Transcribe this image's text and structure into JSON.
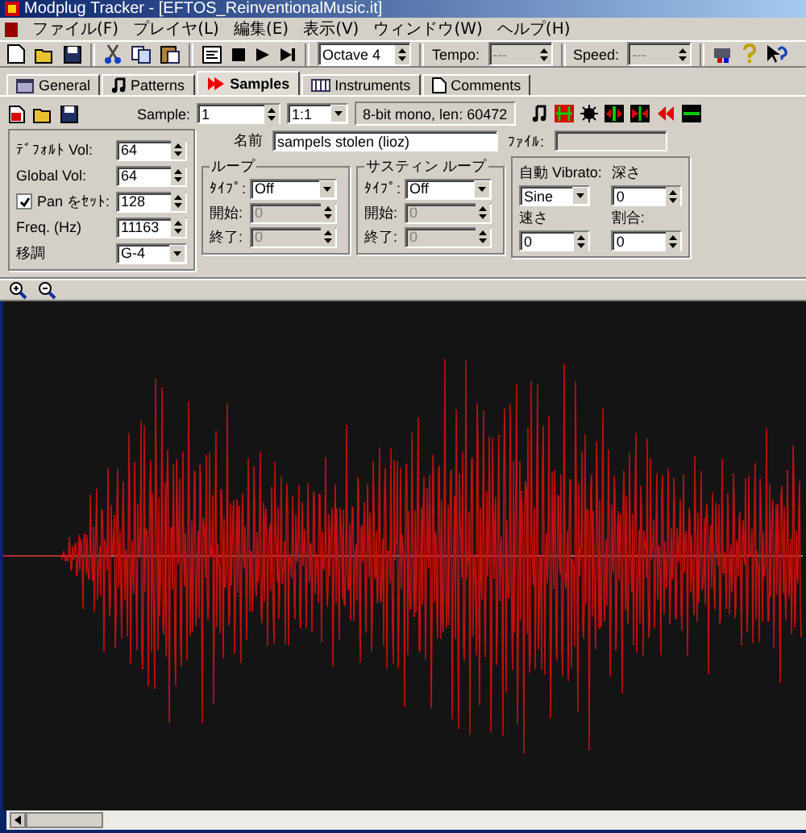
{
  "window": {
    "title": "Modplug Tracker - [EFTOS_ReinventionalMusic.it]"
  },
  "menu": [
    "ファイル(F)",
    "プレイヤ(L)",
    "編集(E)",
    "表示(V)",
    "ウィンドウ(W)",
    "ヘルプ(H)"
  ],
  "toolbar": {
    "octave": "Octave 4",
    "tempo_label": "Tempo:",
    "tempo": "---",
    "speed_label": "Speed:",
    "speed": "---"
  },
  "tabs": [
    {
      "label": "General",
      "selected": false
    },
    {
      "label": "Patterns",
      "selected": false
    },
    {
      "label": "Samples",
      "selected": true
    },
    {
      "label": "Instruments",
      "selected": false
    },
    {
      "label": "Comments",
      "selected": false
    }
  ],
  "sample": {
    "label": "Sample:",
    "number": "1",
    "ratio": "1:1",
    "info": "8-bit mono, len: 60472",
    "name_label": "名前",
    "name": "sampels stolen (lioz)",
    "file_label": "ﾌｧｲﾙ:"
  },
  "left_fields": [
    {
      "kind": "spin",
      "label": "ﾃﾞﾌｫﾙﾄ Vol:",
      "value": "64"
    },
    {
      "kind": "spin",
      "label": "Global Vol:",
      "value": "64"
    },
    {
      "kind": "check",
      "label": "Pan をｾｯﾄ:",
      "value": "128",
      "checked": true
    },
    {
      "kind": "spin",
      "label": "Freq. (Hz)",
      "value": "11163"
    },
    {
      "kind": "select",
      "label": "移調",
      "value": "G-4"
    }
  ],
  "loops": [
    {
      "title": "ループ",
      "type_label": "ﾀｲﾌﾟ:",
      "type": "Off",
      "start_label": "開始:",
      "start": "0",
      "end_label": "終了:",
      "end": "0"
    },
    {
      "title": "サスティン ループ",
      "type_label": "ﾀｲﾌﾟ:",
      "type": "Off",
      "start_label": "開始:",
      "start": "0",
      "end_label": "終了:",
      "end": "0"
    }
  ],
  "vibrato": {
    "label": "自動 Vibrato:",
    "type": "Sine",
    "depth_label": "深さ",
    "depth": "0",
    "speed_label": "速さ",
    "speed": "0",
    "rate_label": "割合:",
    "rate": "0"
  }
}
